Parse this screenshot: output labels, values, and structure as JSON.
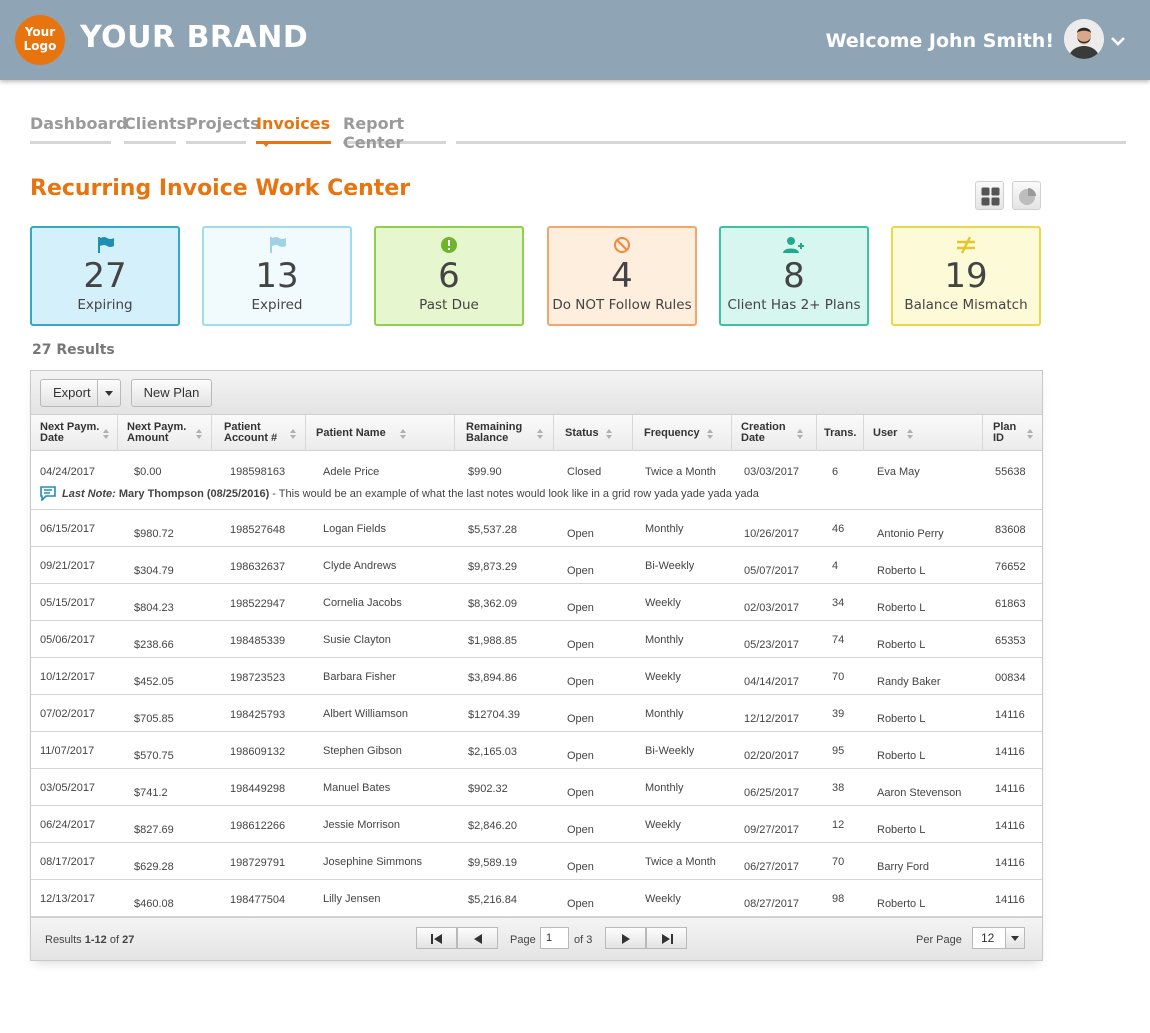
{
  "header": {
    "logo_text_1": "Your",
    "logo_text_2": "Logo",
    "brand": "YOUR BRAND",
    "welcome": "Welcome John Smith!"
  },
  "tabs": [
    {
      "label": "Dashboard"
    },
    {
      "label": "Clients"
    },
    {
      "label": "Projects"
    },
    {
      "label": "Invoices",
      "active": true
    },
    {
      "label": "Report Center"
    }
  ],
  "page_title": "Recurring Invoice Work Center",
  "cards": [
    {
      "icon": "flag-icon",
      "value": "27",
      "label": "Expiring"
    },
    {
      "icon": "flag-icon",
      "value": "13",
      "label": "Expired"
    },
    {
      "icon": "alert-icon",
      "value": "6",
      "label": "Past Due"
    },
    {
      "icon": "prohibited-icon",
      "value": "4",
      "label": "Do NOT Follow Rules"
    },
    {
      "icon": "add-user-icon",
      "value": "8",
      "label": "Client Has 2+ Plans"
    },
    {
      "icon": "not-equal-icon",
      "value": "19",
      "label": "Balance Mismatch"
    }
  ],
  "results_count": "27 Results",
  "toolbar": {
    "export_label": "Export",
    "new_plan_label": "New Plan"
  },
  "columns": [
    {
      "line1": "Next Paym.",
      "line2": "Date"
    },
    {
      "line1": "Next Paym.",
      "line2": "Amount"
    },
    {
      "line1": "Patient",
      "line2": "Account #"
    },
    {
      "line1": "Patient Name",
      "line2": ""
    },
    {
      "line1": "Remaining",
      "line2": "Balance"
    },
    {
      "line1": "Status",
      "line2": ""
    },
    {
      "line1": "Frequency",
      "line2": ""
    },
    {
      "line1": "Creation",
      "line2": "Date"
    },
    {
      "line1": "Trans.",
      "line2": ""
    },
    {
      "line1": "User",
      "line2": ""
    },
    {
      "line1": "Plan",
      "line2": "ID"
    }
  ],
  "rows": [
    {
      "date": "04/24/2017",
      "amount": "$0.00",
      "account": "198598163",
      "name": "Adele Price",
      "balance": "$99.90",
      "status": "Closed",
      "frequency": "Twice a Month",
      "created": "03/03/2017",
      "trans": "6",
      "user": "Eva May",
      "plan": "55638"
    },
    {
      "date": "06/15/2017",
      "amount": "$980.72",
      "account": "198527648",
      "name": "Logan Fields",
      "balance": "$5,537.28",
      "status": "Open",
      "frequency": "Monthly",
      "created": "10/26/2017",
      "trans": "46",
      "user": "Antonio Perry",
      "plan": "83608"
    },
    {
      "date": "09/21/2017",
      "amount": "$304.79",
      "account": "198632637",
      "name": "Clyde Andrews",
      "balance": "$9,873.29",
      "status": "Open",
      "frequency": "Bi-Weekly",
      "created": "05/07/2017",
      "trans": "4",
      "user": "Roberto L",
      "plan": "76652"
    },
    {
      "date": "05/15/2017",
      "amount": "$804.23",
      "account": "198522947",
      "name": "Cornelia Jacobs",
      "balance": "$8,362.09",
      "status": "Open",
      "frequency": "Weekly",
      "created": "02/03/2017",
      "trans": "34",
      "user": "Roberto L",
      "plan": "61863"
    },
    {
      "date": "05/06/2017",
      "amount": "$238.66",
      "account": "198485339",
      "name": "Susie Clayton",
      "balance": "$1,988.85",
      "status": "Open",
      "frequency": "Monthly",
      "created": "05/23/2017",
      "trans": "74",
      "user": "Roberto L",
      "plan": "65353"
    },
    {
      "date": "10/12/2017",
      "amount": "$452.05",
      "account": "198723523",
      "name": "Barbara Fisher",
      "balance": "$3,894.86",
      "status": "Open",
      "frequency": "Weekly",
      "created": "04/14/2017",
      "trans": "70",
      "user": "Randy Baker",
      "plan": "00834"
    },
    {
      "date": "07/02/2017",
      "amount": "$705.85",
      "account": "198425793",
      "name": "Albert Williamson",
      "balance": "$12704.39",
      "status": "Open",
      "frequency": "Monthly",
      "created": "12/12/2017",
      "trans": "39",
      "user": "Roberto L",
      "plan": "14116"
    },
    {
      "date": "11/07/2017",
      "amount": "$570.75",
      "account": "198609132",
      "name": "Stephen Gibson",
      "balance": "$2,165.03",
      "status": "Open",
      "frequency": "Bi-Weekly",
      "created": "02/20/2017",
      "trans": "95",
      "user": "Roberto L",
      "plan": "14116"
    },
    {
      "date": "03/05/2017",
      "amount": "$741.2",
      "account": "198449298",
      "name": "Manuel Bates",
      "balance": "$902.32",
      "status": "Open",
      "frequency": "Monthly",
      "created": "06/25/2017",
      "trans": "38",
      "user": "Aaron Stevenson",
      "plan": "14116"
    },
    {
      "date": "06/24/2017",
      "amount": "$827.69",
      "account": "198612266",
      "name": "Jessie Morrison",
      "balance": "$2,846.20",
      "status": "Open",
      "frequency": "Weekly",
      "created": "09/27/2017",
      "trans": "12",
      "user": "Roberto L",
      "plan": "14116"
    },
    {
      "date": "08/17/2017",
      "amount": "$629.28",
      "account": "198729791",
      "name": "Josephine Simmons",
      "balance": "$9,589.19",
      "status": "Open",
      "frequency": "Twice a Month",
      "created": "06/27/2017",
      "trans": "70",
      "user": "Barry Ford",
      "plan": "14116"
    },
    {
      "date": "12/13/2017",
      "amount": "$460.08",
      "account": "198477504",
      "name": "Lilly Jensen",
      "balance": "$5,216.84",
      "status": "Open",
      "frequency": "Weekly",
      "created": "08/27/2017",
      "trans": "98",
      "user": "Roberto L",
      "plan": "14116"
    }
  ],
  "note": {
    "label": "Last Note:",
    "author": "Mary Thompson (08/25/2016)",
    "text": " - This would be an example of what the last notes would look like in a grid row yada yade yada yada"
  },
  "footer": {
    "results_prefix": "Results ",
    "results_range": "1-12",
    "results_of": " of ",
    "results_total": "27",
    "page_label": "Page",
    "page_value": "1",
    "page_of": "of 3",
    "per_page_label": "Per Page",
    "per_page_value": "12"
  },
  "colors": {
    "header_bg": "#8fa4b5",
    "accent": "#e8740f"
  }
}
